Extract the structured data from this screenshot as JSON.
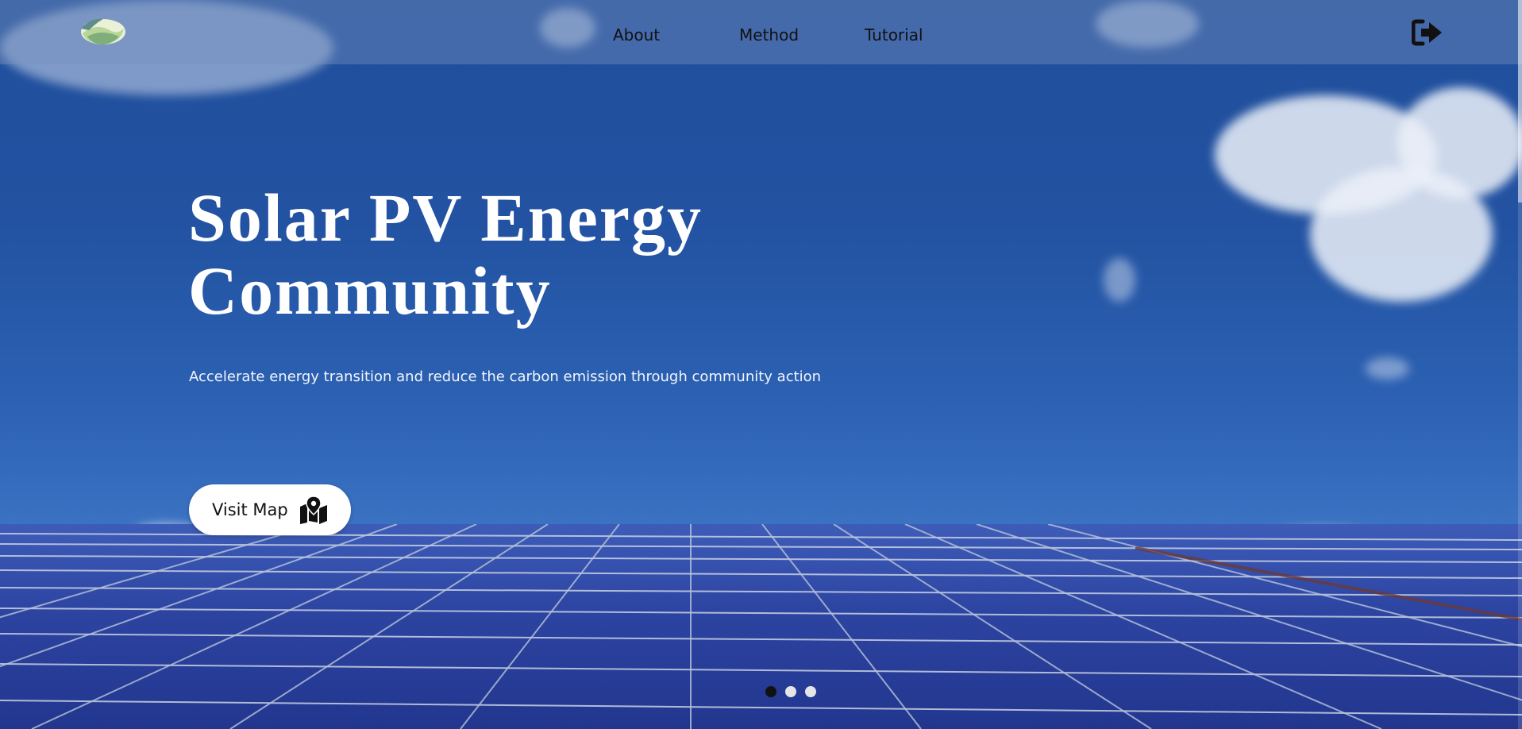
{
  "nav": {
    "logo_icon": "leaf-logo-icon",
    "links": [
      {
        "label": "About"
      },
      {
        "label": "Method"
      },
      {
        "label": "Tutorial"
      }
    ],
    "logout_icon": "sign-out-icon"
  },
  "hero": {
    "title_line1": "Solar PV Energy",
    "title_line2": "Community",
    "subtitle": "Accelerate energy transition and reduce the carbon emission through community action",
    "cta_label": "Visit Map",
    "cta_icon": "map-marker-icon"
  },
  "carousel": {
    "slide_count": 3,
    "active_index": 0
  },
  "colors": {
    "sky": "#2252a1",
    "nav_bg": "#7891be",
    "title": "#ffffff",
    "button_bg": "#ffffff",
    "dot_active": "#111111",
    "dot_inactive": "#e6e6e6"
  }
}
